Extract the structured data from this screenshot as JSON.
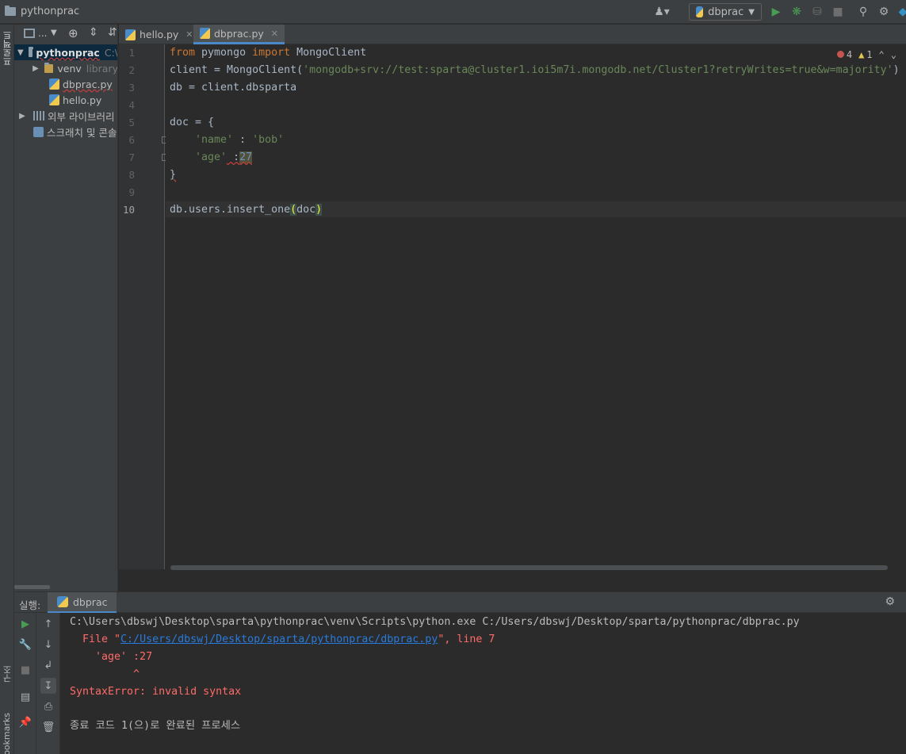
{
  "window": {
    "project_name": "pythonprac"
  },
  "toolbar": {
    "run_config": "dbprac",
    "icons": [
      "user-icon",
      "run-icon",
      "debug-icon",
      "coverage-icon",
      "stop-icon",
      "search-icon",
      "gear-icon"
    ]
  },
  "left_strip": {
    "project_label": "프로젝트",
    "structure_label": "구조",
    "bookmarks_label": "Bookmarks"
  },
  "project_panel": {
    "toolbar_label": "...",
    "tree": [
      {
        "label": "pythonprac",
        "extra": "C:\\",
        "expanded": true,
        "depth": 0
      },
      {
        "label": "venv",
        "extra": "library",
        "expanded": false,
        "depth": 1
      },
      {
        "label": "dbprac.py",
        "depth": 1
      },
      {
        "label": "hello.py",
        "depth": 1
      },
      {
        "label": "외부 라이브러리",
        "depth": 0
      },
      {
        "label": "스크래치 및 콘솔",
        "depth": 0
      }
    ]
  },
  "tabs": [
    {
      "label": "hello.py",
      "active": false
    },
    {
      "label": "dbprac.py",
      "active": true
    }
  ],
  "editor": {
    "line_numbers": [
      "1",
      "2",
      "3",
      "4",
      "5",
      "6",
      "7",
      "8",
      "9",
      "10"
    ],
    "current_line": "10",
    "inspection": {
      "errors": "4",
      "warnings": "1"
    },
    "code": {
      "l1_kw1": "from",
      "l1_mod": " pymongo ",
      "l1_kw2": "import",
      "l1_name": " MongoClient",
      "l2_pre": "client = MongoClient(",
      "l2_str": "'mongodb+srv://test:sparta@cluster1.ioi5m7i.mongodb.net/Cluster1?retryWrites=true&w=majority'",
      "l2_post": ")",
      "l3": "db = client.dbsparta",
      "l5": "doc = {",
      "l6_str1": "'name'",
      "l6_mid": " : ",
      "l6_str2": "'bob'",
      "l7_str": "'age'",
      "l7_mid": " :",
      "l7_num": "27",
      "l8": "}",
      "l10_pre": "db.users.insert_one",
      "l10_open": "(",
      "l10_arg": "doc",
      "l10_close": ")"
    }
  },
  "run_panel": {
    "label": "실행:",
    "tab": "dbprac",
    "console": {
      "line1": "C:\\Users\\dbswj\\Desktop\\sparta\\pythonprac\\venv\\Scripts\\python.exe C:/Users/dbswj/Desktop/sparta/pythonprac/dbprac.py",
      "line2_pre": "  File \"",
      "line2_link": "C:/Users/dbswj/Desktop/sparta/pythonprac/dbprac.py",
      "line2_post": "\", line 7",
      "line3": "    'age' :27",
      "line4": "          ^",
      "line5": "SyntaxError: invalid syntax",
      "line6": "종료 코드 1(으)로 완료된 프로세스"
    }
  }
}
